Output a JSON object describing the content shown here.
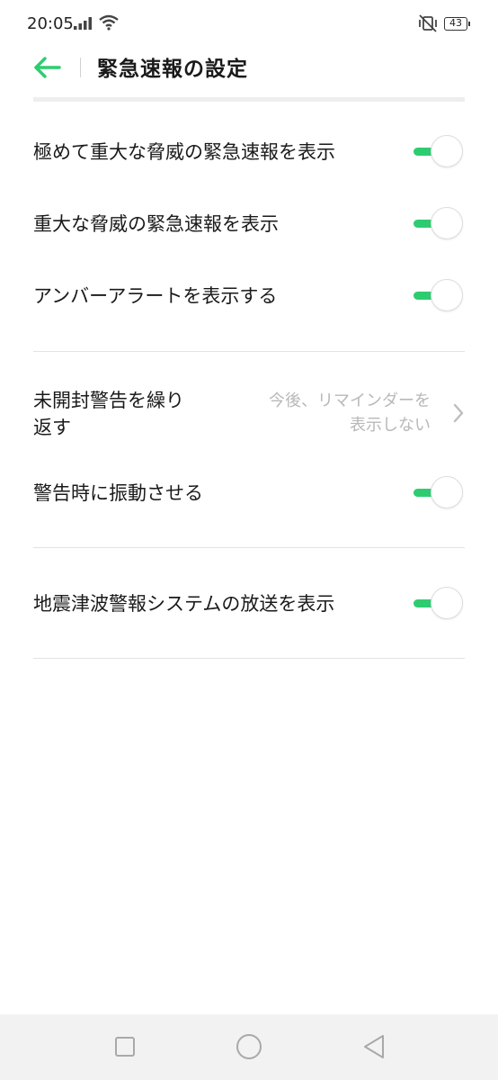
{
  "status_bar": {
    "time": "20:05",
    "battery": "43"
  },
  "header": {
    "title": "緊急速報の設定"
  },
  "settings": {
    "extreme_threat": {
      "label": "極めて重大な脅威の緊急速報を表示",
      "on": true
    },
    "severe_threat": {
      "label": "重大な脅威の緊急速報を表示",
      "on": true
    },
    "amber_alert": {
      "label": "アンバーアラートを表示する",
      "on": true
    },
    "repeat_unread": {
      "label_line1": "未開封警告を繰り",
      "label_line2": "返す",
      "value_line1": "今後、リマインダーを",
      "value_line2": "表示しない"
    },
    "vibrate": {
      "label": "警告時に振動させる",
      "on": true
    },
    "etws": {
      "label": "地震津波警報システムの放送を表示",
      "on": true
    }
  },
  "colors": {
    "accent": "#2ecc71",
    "secondary_text": "#b8b8b8"
  },
  "icons": {
    "back": "arrow-left-icon",
    "chevron": "chevron-right-icon",
    "nav": [
      "square-icon",
      "circle-icon",
      "triangle-back-icon"
    ]
  }
}
